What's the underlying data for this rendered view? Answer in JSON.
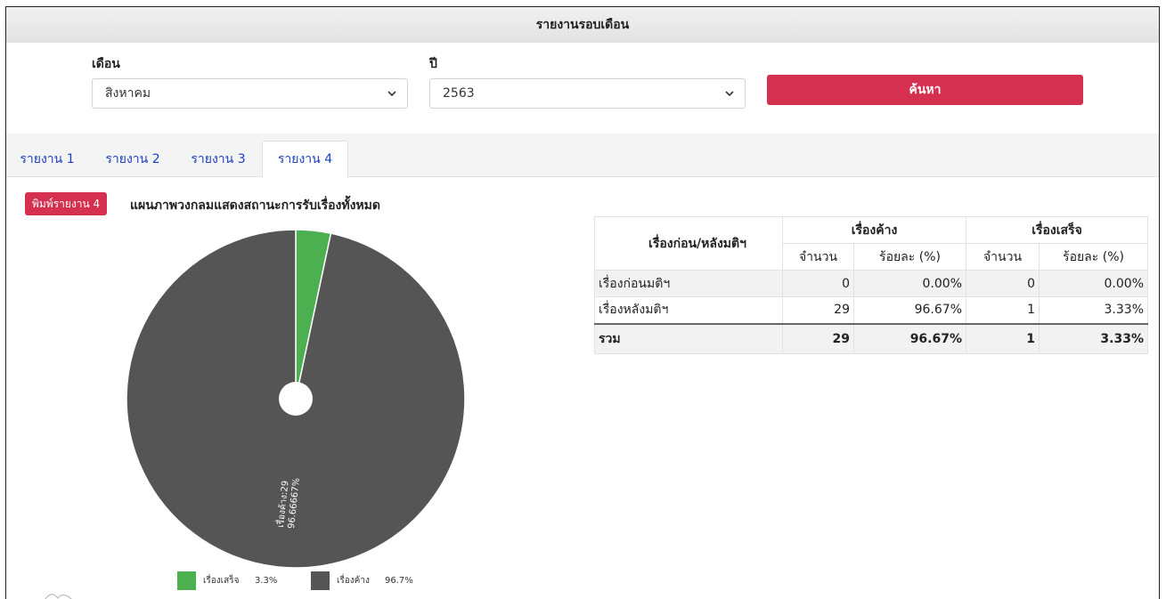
{
  "header": {
    "title": "รายงานรอบเดือน"
  },
  "filters": {
    "month_label": "เดือน",
    "month_value": "สิงหาคม",
    "year_label": "ปี",
    "year_value": "2563",
    "search_label": "ค้นหา"
  },
  "tabs": [
    {
      "label": "รายงาน 1"
    },
    {
      "label": "รายงาน 2"
    },
    {
      "label": "รายงาน 3"
    },
    {
      "label": "รายงาน 4",
      "active": true
    }
  ],
  "report": {
    "print_label": "พิมพ์รายงาน 4",
    "chart_title": "แผนภาพวงกลมแสดงสถานะการรับเรื่องทั้งหมด"
  },
  "chart_data": {
    "type": "pie",
    "categories": [
      "เรื่องเสร็จ",
      "เรื่องค้าง"
    ],
    "values": [
      1,
      29
    ],
    "colors": [
      "#4caf50",
      "#555555"
    ],
    "slice_label": {
      "line1": "เรื่องค้าง:29",
      "line2": "96.66667%"
    },
    "legend": [
      {
        "name": "เรื่องเสร็จ",
        "percent": "3.3%",
        "color": "#4caf50"
      },
      {
        "name": "เรื่องค้าง",
        "percent": "96.7%",
        "color": "#555555"
      }
    ]
  },
  "table": {
    "row_header": "เรื่องก่อน/หลังมติฯ",
    "group_pending": "เรื่องค้าง",
    "group_done": "เรื่องเสร็จ",
    "sub_count": "จำนวน",
    "sub_percent": "ร้อยละ (%)",
    "rows": [
      {
        "name": "เรื่องก่อนมติฯ",
        "pending_count": "0",
        "pending_pct": "0.00%",
        "done_count": "0",
        "done_pct": "0.00%"
      },
      {
        "name": "เรื่องหลังมติฯ",
        "pending_count": "29",
        "pending_pct": "96.67%",
        "done_count": "1",
        "done_pct": "3.33%"
      }
    ],
    "total": {
      "name": "รวม",
      "pending_count": "29",
      "pending_pct": "96.67%",
      "done_count": "1",
      "done_pct": "3.33%"
    }
  }
}
